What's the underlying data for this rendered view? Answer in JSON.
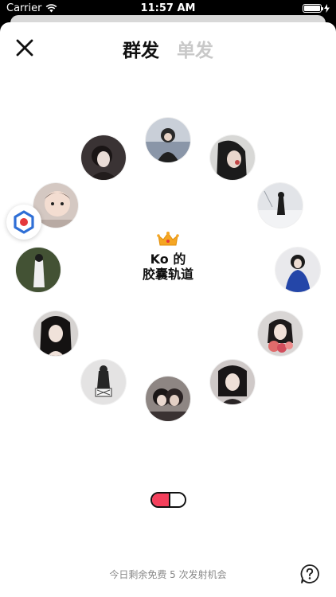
{
  "status_bar": {
    "carrier": "Carrier",
    "time": "11:57 AM"
  },
  "tabs": [
    {
      "label": "群发",
      "active": true
    },
    {
      "label": "单发",
      "active": false
    }
  ],
  "center": {
    "line1": "Ko 的",
    "line2": "胶囊轨道"
  },
  "footer": {
    "note": "今日剩余免费 5 次发射机会"
  },
  "icons": {
    "close": "close-icon",
    "crown": "crown-icon",
    "help": "help-icon",
    "logo": "app-logo-icon",
    "wifi": "wifi-icon",
    "battery": "battery-icon",
    "capsule": "capsule-icon"
  },
  "colors": {
    "accent": "#f4405c",
    "inactive_tab": "#c8c8c8",
    "crown": "#f5a623"
  }
}
